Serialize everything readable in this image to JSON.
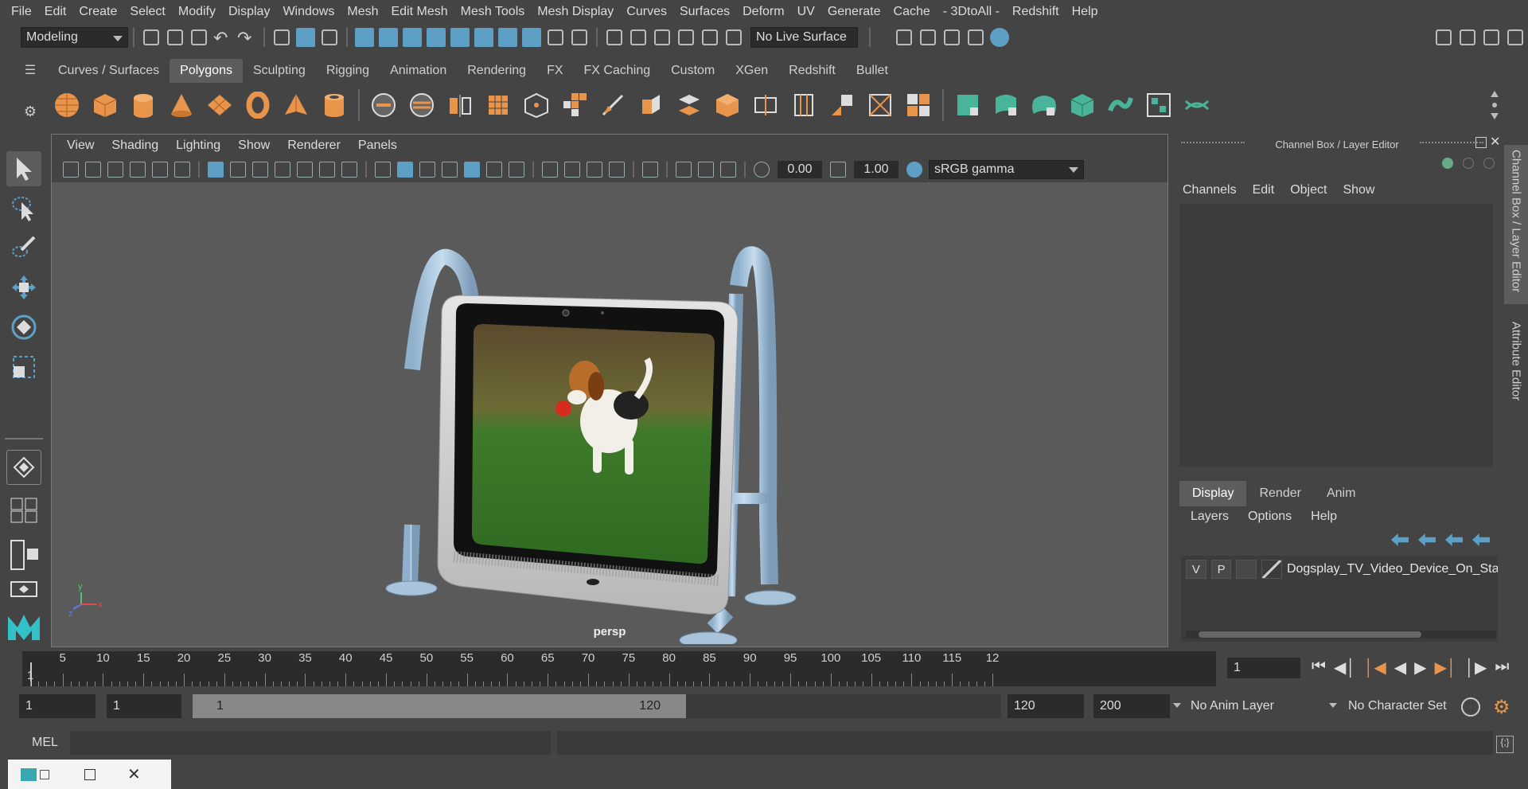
{
  "menubar": [
    "File",
    "Edit",
    "Create",
    "Select",
    "Modify",
    "Display",
    "Windows",
    "Mesh",
    "Edit Mesh",
    "Mesh Tools",
    "Mesh Display",
    "Curves",
    "Surfaces",
    "Deform",
    "UV",
    "Generate",
    "Cache",
    "- 3DtoAll -",
    "Redshift",
    "Help"
  ],
  "statusline": {
    "mode": "Modeling",
    "live_surface": "No Live Surface"
  },
  "shelf": {
    "tabs": [
      "Curves / Surfaces",
      "Polygons",
      "Sculpting",
      "Rigging",
      "Animation",
      "Rendering",
      "FX",
      "FX Caching",
      "Custom",
      "XGen",
      "Redshift",
      "Bullet"
    ],
    "active_tab": "Polygons"
  },
  "viewport": {
    "menu": [
      "View",
      "Shading",
      "Lighting",
      "Show",
      "Renderer",
      "Panels"
    ],
    "exposure": "0.00",
    "gamma": "1.00",
    "color_space": "sRGB gamma",
    "camera_label": "persp"
  },
  "channel_box": {
    "title": "Channel Box / Layer Editor",
    "menu": [
      "Channels",
      "Edit",
      "Object",
      "Show"
    ]
  },
  "side_tabs": [
    "Channel Box / Layer Editor",
    "Attribute Editor"
  ],
  "layer_editor": {
    "tabs": [
      "Display",
      "Render",
      "Anim"
    ],
    "active_tab": "Display",
    "menu": [
      "Layers",
      "Options",
      "Help"
    ],
    "layer": {
      "v": "V",
      "p": "P",
      "name": "Dogsplay_TV_Video_Device_On_State"
    }
  },
  "timeline": {
    "ticks": [
      "5",
      "10",
      "15",
      "20",
      "25",
      "30",
      "35",
      "40",
      "45",
      "50",
      "55",
      "60",
      "65",
      "70",
      "75",
      "80",
      "85",
      "90",
      "95",
      "100",
      "105",
      "110",
      "115",
      "12"
    ],
    "first_frame_label": "1",
    "current_frame": "1"
  },
  "range": {
    "start": "1",
    "playback_start": "1",
    "slider_start": "1",
    "slider_end": "120",
    "playback_end": "120",
    "end": "200",
    "anim_layer": "No Anim Layer",
    "char_set": "No Character Set"
  },
  "cmdline": {
    "label": "MEL"
  },
  "colors": {
    "accent_blue": "#5e9fc5",
    "shelf_orange": "#e8944a",
    "shelf_green": "#49b49a"
  }
}
